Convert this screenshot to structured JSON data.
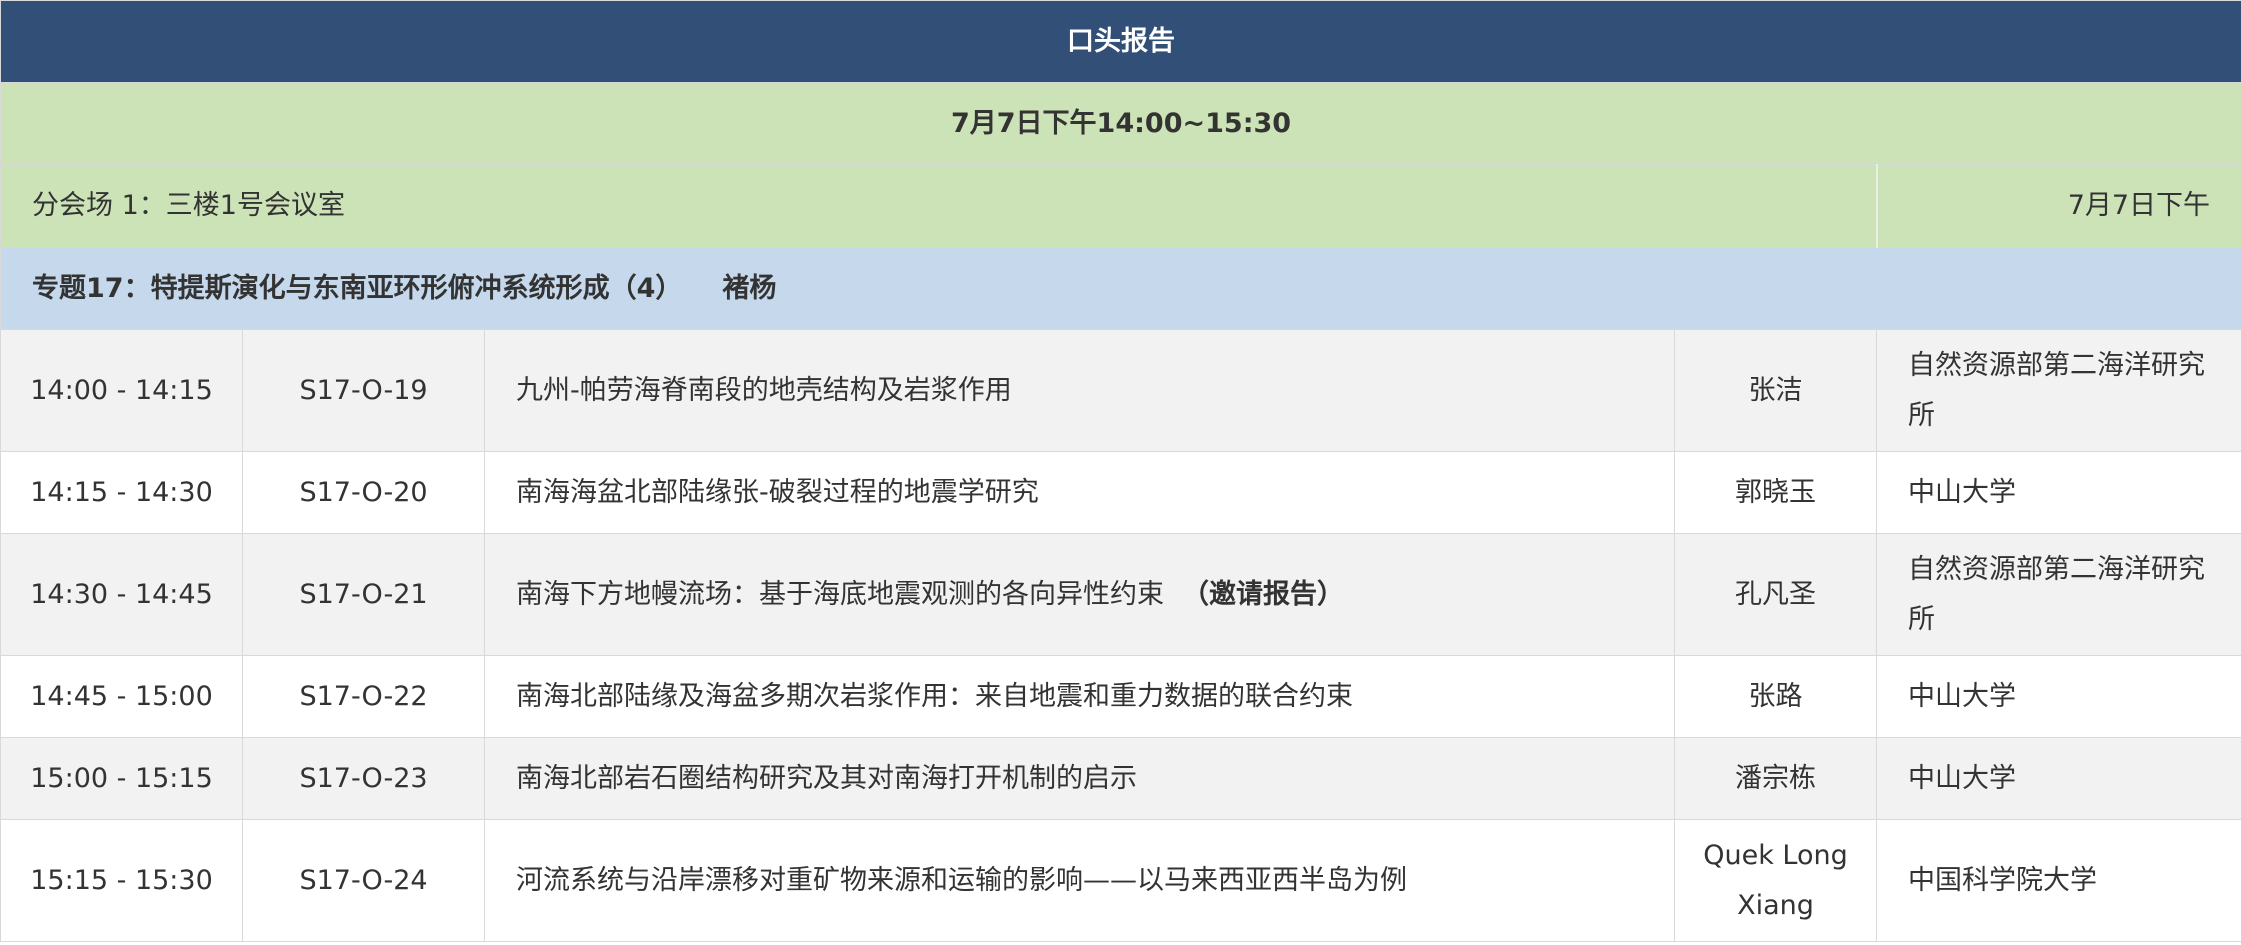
{
  "header": {
    "title": "口头报告",
    "session_time": "7月7日下午14:00~15:30"
  },
  "venue": {
    "name": "分会场 1：三楼1号会议室",
    "date": "7月7日下午"
  },
  "topic": {
    "title": "专题17：特提斯演化与东南亚环形俯冲系统形成（4）",
    "chair": "褚杨"
  },
  "talks": [
    {
      "time": "14:00 - 14:15",
      "code": "S17-O-19",
      "title": "九州-帕劳海脊南段的地壳结构及岩浆作用",
      "tag": "",
      "speaker": "张洁",
      "institution": "自然资源部第二海洋研究所"
    },
    {
      "time": "14:15 - 14:30",
      "code": "S17-O-20",
      "title": "南海海盆北部陆缘张-破裂过程的地震学研究",
      "tag": "",
      "speaker": "郭晓玉",
      "institution": "中山大学"
    },
    {
      "time": "14:30 - 14:45",
      "code": "S17-O-21",
      "title": "南海下方地幔流场：基于海底地震观测的各向异性约束",
      "tag": "（邀请报告）",
      "speaker": "孔凡圣",
      "institution": "自然资源部第二海洋研究所"
    },
    {
      "time": "14:45 - 15:00",
      "code": "S17-O-22",
      "title": "南海北部陆缘及海盆多期次岩浆作用：来自地震和重力数据的联合约束",
      "tag": "",
      "speaker": "张路",
      "institution": "中山大学"
    },
    {
      "time": "15:00 - 15:15",
      "code": "S17-O-23",
      "title": "南海北部岩石圈结构研究及其对南海打开机制的启示",
      "tag": "",
      "speaker": "潘宗栋",
      "institution": "中山大学"
    },
    {
      "time": "15:15 - 15:30",
      "code": "S17-O-24",
      "title": "河流系统与沿岸漂移对重矿物来源和运输的影响——以马来西亚西半岛为例",
      "tag": "",
      "speaker": "Quek Long Xiang",
      "institution": "中国科学院大学"
    }
  ],
  "colors": {
    "header_bg": "#324f78",
    "session_bg": "#cce2b7",
    "topic_bg": "#c6d8ec",
    "row_shaded_bg": "#f2f2f2",
    "row_plain_bg": "#ffffff",
    "text": "#333333"
  }
}
